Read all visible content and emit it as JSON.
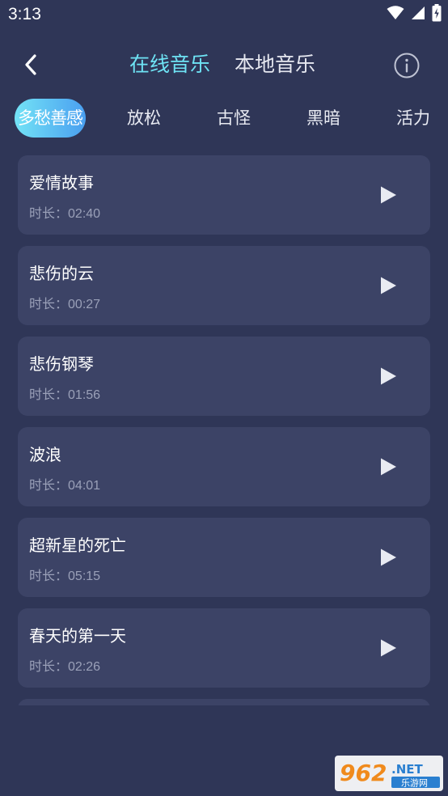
{
  "status_bar": {
    "time": "3:13",
    "icons": [
      "wifi-icon",
      "cell-signal-icon",
      "battery-charging-icon"
    ]
  },
  "header": {
    "back_icon": "chevron-left-icon",
    "tabs": [
      {
        "label": "在线音乐",
        "active": true
      },
      {
        "label": "本地音乐",
        "active": false
      }
    ],
    "info_icon": "info-icon",
    "accent_color": "#6ee3f4"
  },
  "categories": [
    {
      "label": "多愁善感",
      "active": true
    },
    {
      "label": "放松",
      "active": false
    },
    {
      "label": "古怪",
      "active": false
    },
    {
      "label": "黑暗",
      "active": false
    },
    {
      "label": "活力",
      "active": false
    }
  ],
  "duration_prefix": "时长：",
  "tracks": [
    {
      "title": "爱情故事",
      "duration": "02:40"
    },
    {
      "title": "悲伤的云",
      "duration": "00:27"
    },
    {
      "title": "悲伤钢琴",
      "duration": "01:56"
    },
    {
      "title": "波浪",
      "duration": "04:01"
    },
    {
      "title": "超新星的死亡",
      "duration": "05:15"
    },
    {
      "title": "春天的第一天",
      "duration": "02:26"
    }
  ],
  "watermark": {
    "brand": "962",
    "suffix": ".NET",
    "tagline": "乐游网"
  },
  "colors": {
    "background": "#2f3657",
    "card": "#3c4366",
    "muted_text": "#9aa0b8",
    "chip_gradient_start": "#73e3f6",
    "chip_gradient_end": "#4a9ff0"
  }
}
